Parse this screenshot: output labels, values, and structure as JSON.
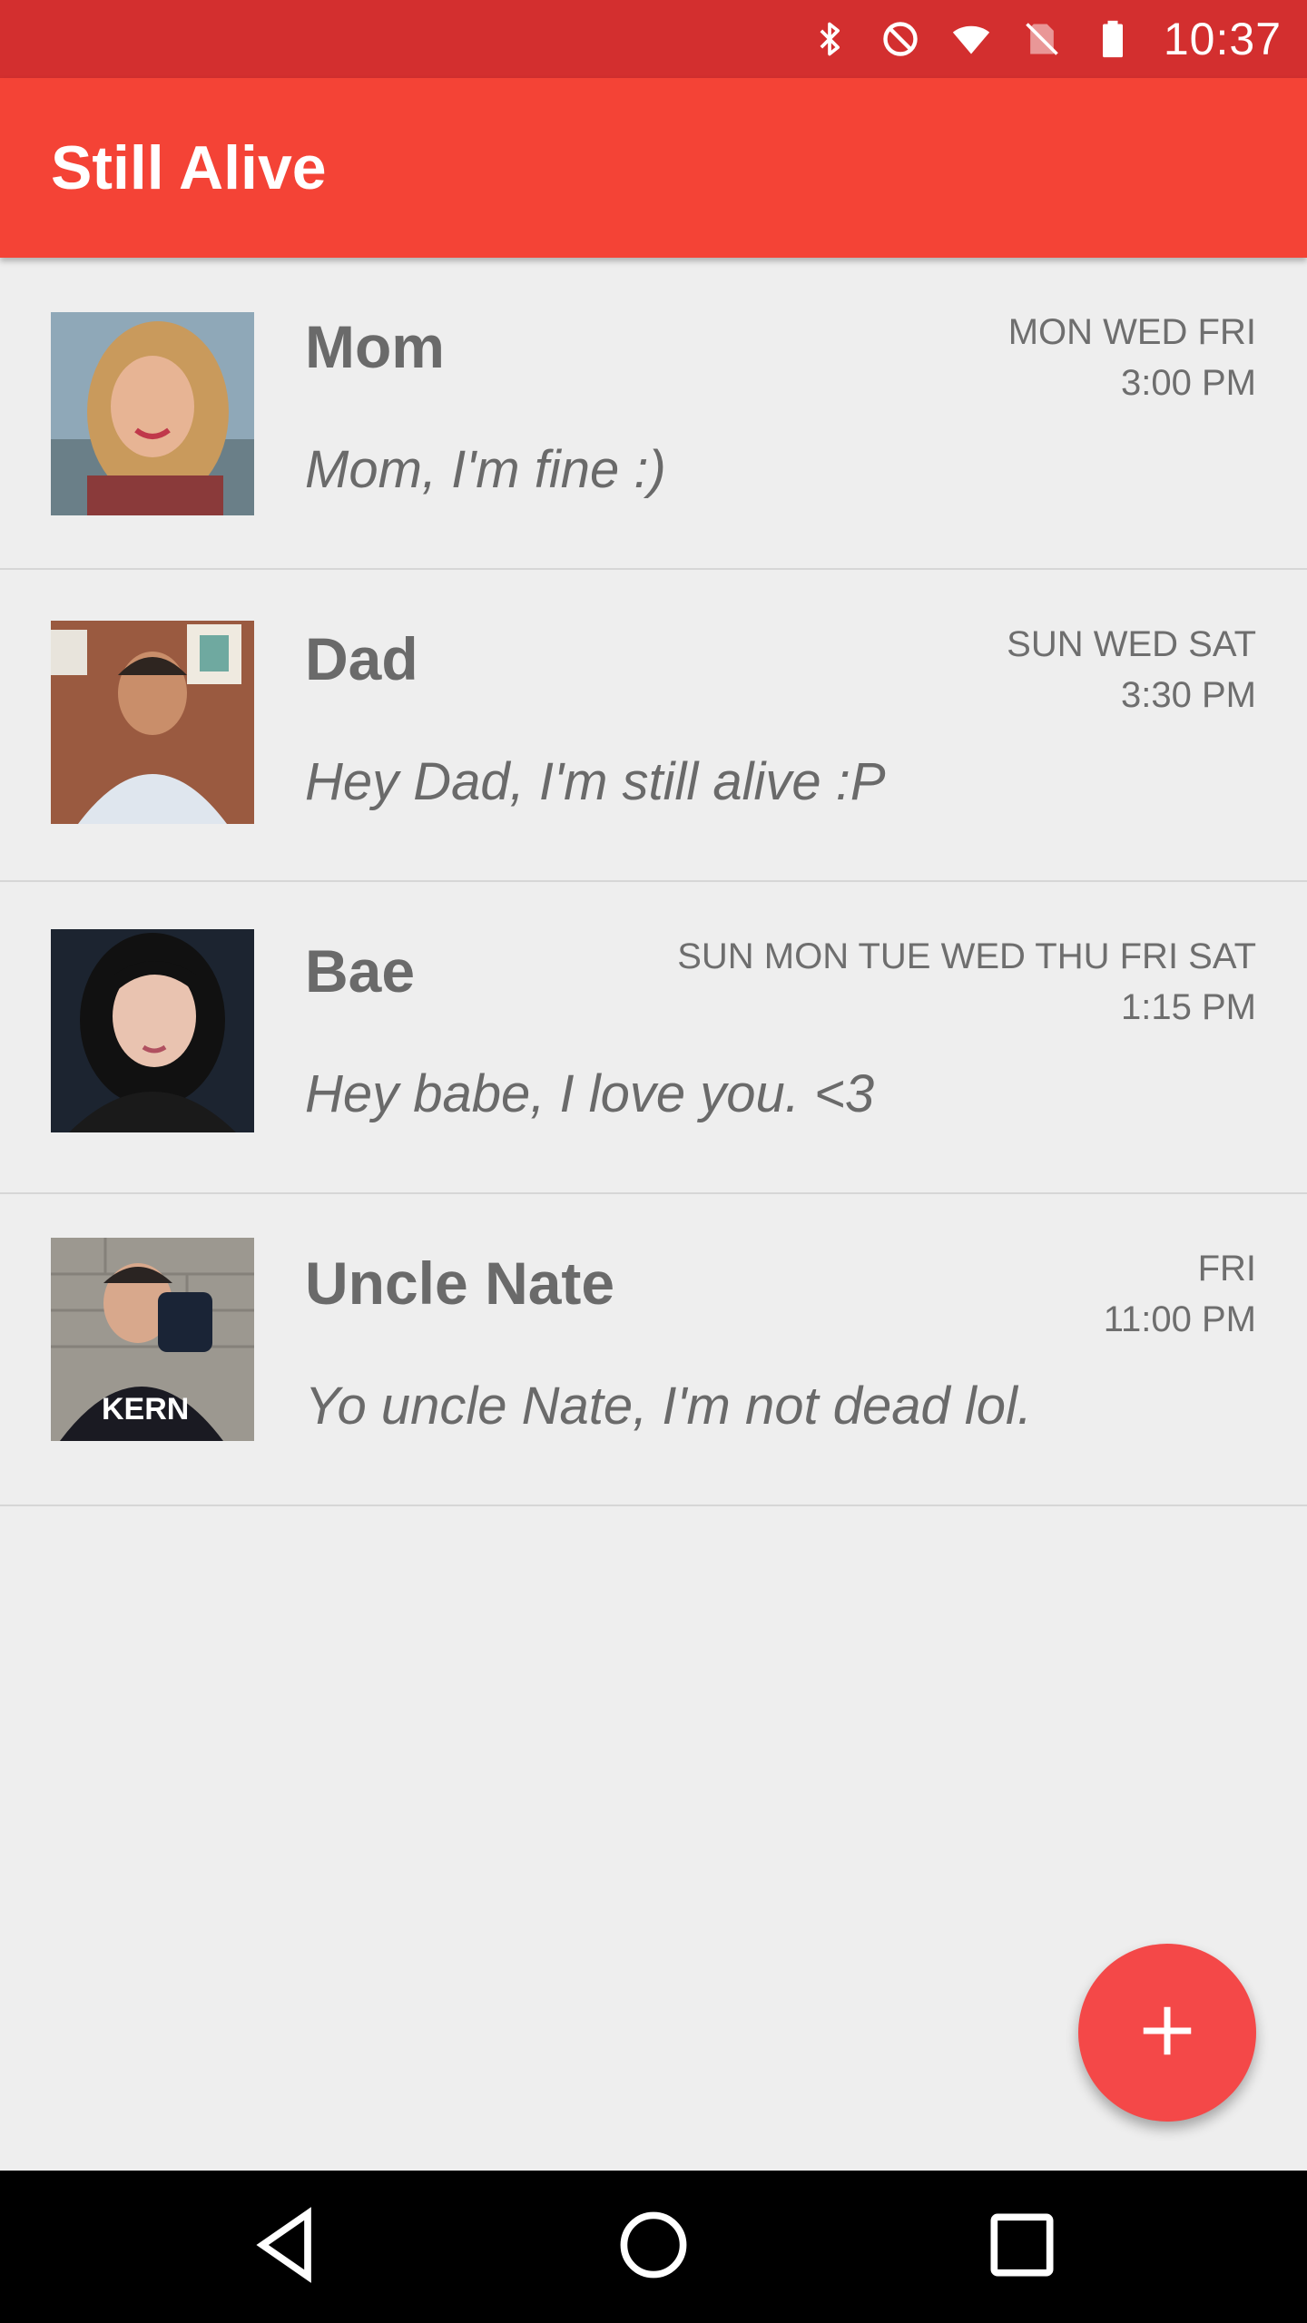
{
  "status_bar": {
    "time": "10:37",
    "icons": [
      "bluetooth-icon",
      "do-not-disturb-icon",
      "wifi-icon",
      "no-sim-icon",
      "battery-icon"
    ]
  },
  "app_bar": {
    "title": "Still Alive"
  },
  "contacts": [
    {
      "name": "Mom",
      "days": "MON WED FRI",
      "time": "3:00 PM",
      "message": "Mom, I'm fine :)"
    },
    {
      "name": "Dad",
      "days": "SUN WED SAT",
      "time": "3:30 PM",
      "message": "Hey Dad, I'm still alive :P"
    },
    {
      "name": "Bae",
      "days": "SUN MON TUE WED THU FRI SAT",
      "time": "1:15 PM",
      "message": "Hey babe, I love you. <3"
    },
    {
      "name": "Uncle Nate",
      "days": "FRI",
      "time": "11:00 PM",
      "message": "Yo uncle Nate, I'm not dead lol."
    }
  ],
  "fab": {
    "icon": "plus-icon"
  },
  "nav_bar": {
    "icons": [
      "back-icon",
      "home-icon",
      "recents-icon"
    ]
  },
  "colors": {
    "status_bar": "#d32f2f",
    "app_bar": "#f44336",
    "fab": "#f44848",
    "background": "#eeeeee",
    "text": "#6a6a6a"
  }
}
